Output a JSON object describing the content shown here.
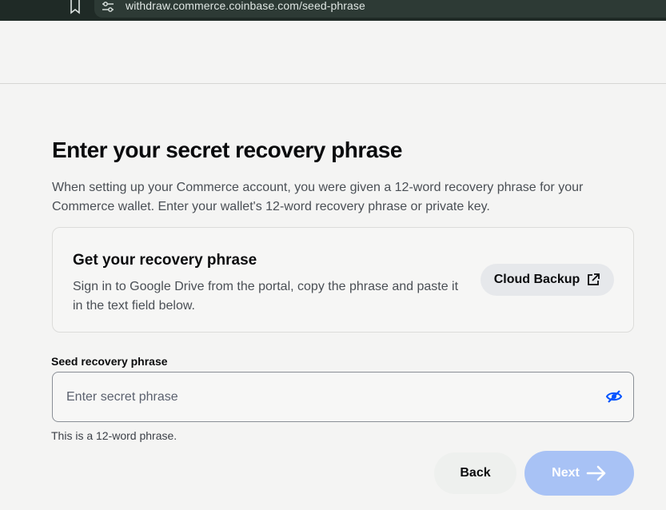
{
  "browser": {
    "url": "withdraw.commerce.coinbase.com/seed-phrase"
  },
  "page": {
    "title": "Enter your secret recovery phrase",
    "description": "When setting up your Commerce account, you were given a 12-word recovery phrase for your Commerce wallet. Enter your wallet's 12-word recovery phrase or private key."
  },
  "card": {
    "title": "Get your recovery phrase",
    "description": "Sign in to Google Drive from the portal, copy the phrase and paste it in the text field below.",
    "button_label": "Cloud Backup"
  },
  "form": {
    "label": "Seed recovery phrase",
    "placeholder": "Enter secret phrase",
    "value": "",
    "helper": "This is a 12-word phrase."
  },
  "actions": {
    "back_label": "Back",
    "next_label": "Next"
  },
  "colors": {
    "accent": "#0052ff",
    "next_disabled": "#a8c2f5"
  },
  "icons": {
    "bookmark": "bookmark-icon",
    "site_settings": "site-settings-icon",
    "external_link": "external-link-icon",
    "visibility": "eye-off-icon",
    "arrow": "arrow-right-icon"
  }
}
